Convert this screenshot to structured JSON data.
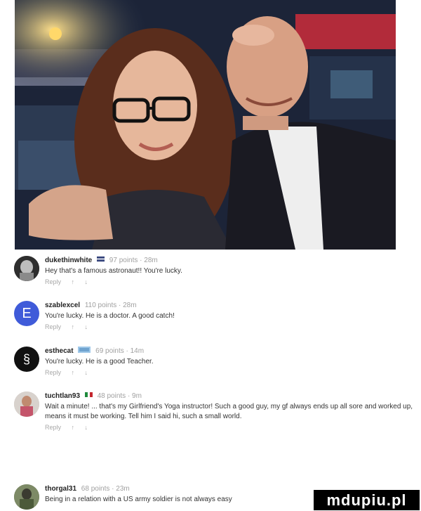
{
  "comments": [
    {
      "username": "dukethinwhite",
      "points": "97 points · 28m",
      "text": "Hey that's a famous astronaut!! You're lucky.",
      "reply_label": "Reply",
      "upvote_icon": "arrow-up-icon",
      "downvote_icon": "arrow-down-icon"
    },
    {
      "username": "szablexcel",
      "avatar_letter": "E",
      "points": "110 points · 28m",
      "text": "You're lucky. He is a doctor. A good catch!",
      "reply_label": "Reply",
      "upvote_icon": "arrow-up-icon",
      "downvote_icon": "arrow-down-icon"
    },
    {
      "username": "esthecat",
      "avatar_letter": "§",
      "points": "69 points · 14m",
      "text": "You're lucky. He is a good Teacher.",
      "reply_label": "Reply",
      "upvote_icon": "arrow-up-icon",
      "downvote_icon": "arrow-down-icon"
    },
    {
      "username": "tuchtlan93",
      "points": "48 points · 9m",
      "text": "Wait a minute! ... that's my Girlfriend's Yoga instructor! Such a good guy, my gf always ends up all sore and worked up, means it must be working. Tell him I said hi, such a small world.",
      "reply_label": "Reply",
      "upvote_icon": "arrow-up-icon",
      "downvote_icon": "arrow-down-icon"
    },
    {
      "username": "thorgal31",
      "points": "68 points · 23m",
      "text": "Being in a relation with a US army soldier is not always easy",
      "reply_label": "",
      "upvote_icon": "arrow-up-icon",
      "downvote_icon": "arrow-down-icon"
    }
  ],
  "watermark": "mdupiu.pl",
  "colors": {
    "username": "#222222",
    "meta": "#a0a0a0",
    "text": "#333333",
    "avatar_blue": "#3f5bd9"
  }
}
